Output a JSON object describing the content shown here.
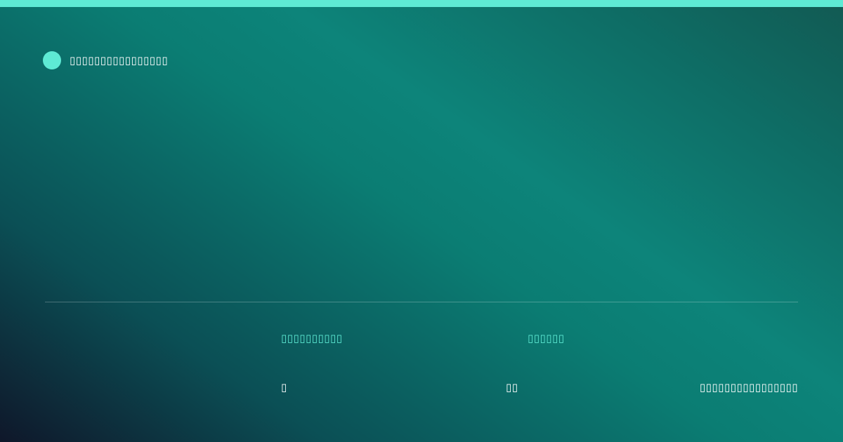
{
  "colors": {
    "accent": "#5eead4",
    "text": "#ffffff"
  },
  "brand": {
    "name": "▯▯▯▯▯▯▯▯▯▯▯▯▯▯▯▯"
  },
  "meta": {
    "labels": [
      "▯▯▯▯▯▯▯▯▯▯",
      "▯▯▯▯▯▯"
    ],
    "values": [
      "▯",
      "▯▯",
      "▯▯▯▯▯▯▯▯▯▯▯▯▯▯▯▯"
    ]
  }
}
